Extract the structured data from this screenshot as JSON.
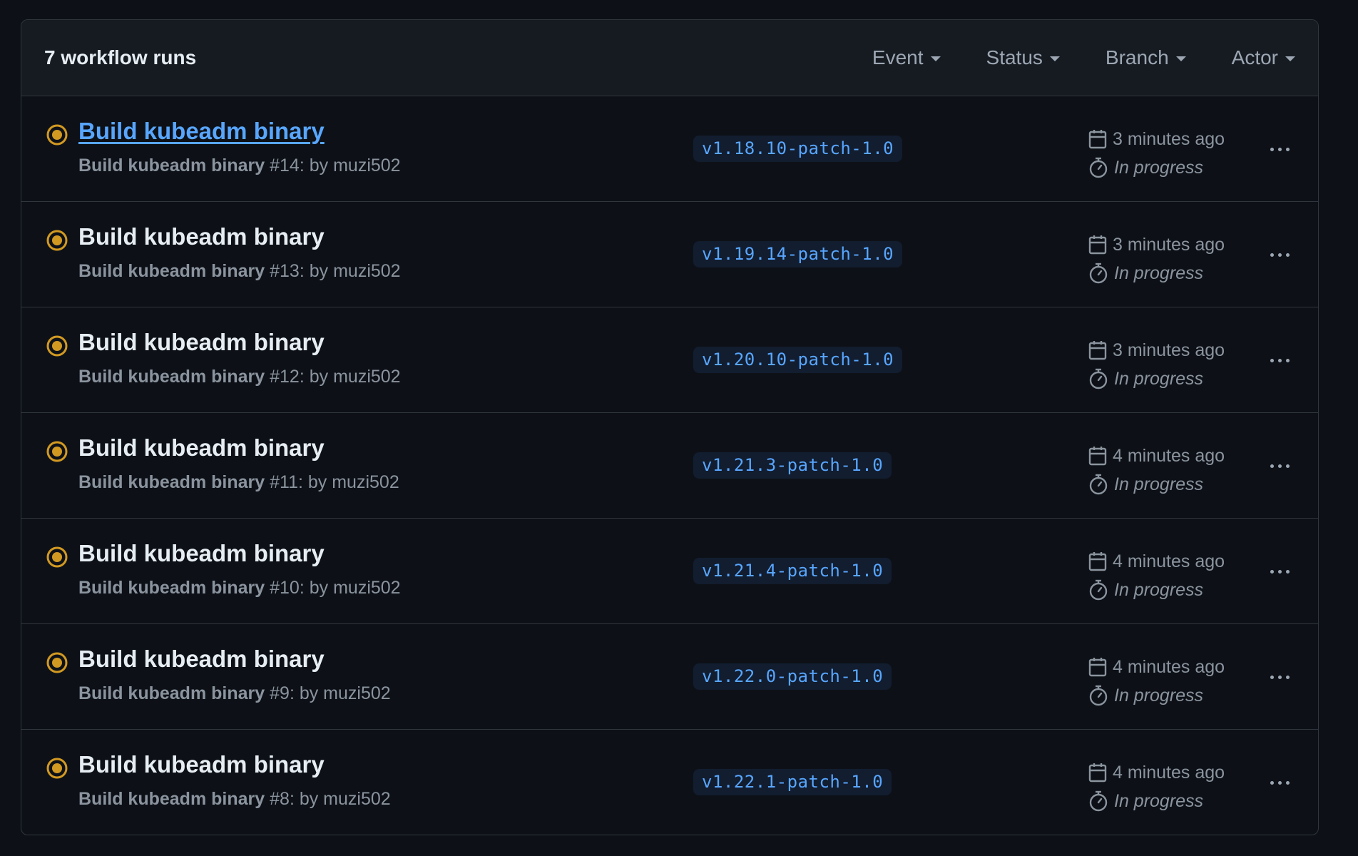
{
  "header": {
    "runs_count": "7 workflow runs",
    "filters": [
      {
        "label": "Event"
      },
      {
        "label": "Status"
      },
      {
        "label": "Branch"
      },
      {
        "label": "Actor"
      }
    ]
  },
  "colors": {
    "in_progress": "#d29922",
    "link": "#58a6ff"
  },
  "runs": [
    {
      "title": "Build kubeadm binary",
      "workflow": "Build kubeadm binary",
      "number": "#14",
      "actor_text": ": by muzi502",
      "branch": "v1.18.10-patch-1.0",
      "time": "3 minutes ago",
      "status": "In progress",
      "status_icon": "in-progress-icon",
      "highlighted": true
    },
    {
      "title": "Build kubeadm binary",
      "workflow": "Build kubeadm binary",
      "number": "#13",
      "actor_text": ": by muzi502",
      "branch": "v1.19.14-patch-1.0",
      "time": "3 minutes ago",
      "status": "In progress",
      "status_icon": "in-progress-icon",
      "highlighted": false
    },
    {
      "title": "Build kubeadm binary",
      "workflow": "Build kubeadm binary",
      "number": "#12",
      "actor_text": ": by muzi502",
      "branch": "v1.20.10-patch-1.0",
      "time": "3 minutes ago",
      "status": "In progress",
      "status_icon": "in-progress-icon",
      "highlighted": false
    },
    {
      "title": "Build kubeadm binary",
      "workflow": "Build kubeadm binary",
      "number": "#11",
      "actor_text": ": by muzi502",
      "branch": "v1.21.3-patch-1.0",
      "time": "4 minutes ago",
      "status": "In progress",
      "status_icon": "in-progress-icon",
      "highlighted": false
    },
    {
      "title": "Build kubeadm binary",
      "workflow": "Build kubeadm binary",
      "number": "#10",
      "actor_text": ": by muzi502",
      "branch": "v1.21.4-patch-1.0",
      "time": "4 minutes ago",
      "status": "In progress",
      "status_icon": "in-progress-icon",
      "highlighted": false
    },
    {
      "title": "Build kubeadm binary",
      "workflow": "Build kubeadm binary",
      "number": "#9",
      "actor_text": ": by muzi502",
      "branch": "v1.22.0-patch-1.0",
      "time": "4 minutes ago",
      "status": "In progress",
      "status_icon": "in-progress-icon",
      "highlighted": false
    },
    {
      "title": "Build kubeadm binary",
      "workflow": "Build kubeadm binary",
      "number": "#8",
      "actor_text": ": by muzi502",
      "branch": "v1.22.1-patch-1.0",
      "time": "4 minutes ago",
      "status": "In progress",
      "status_icon": "in-progress-icon",
      "highlighted": false
    }
  ]
}
